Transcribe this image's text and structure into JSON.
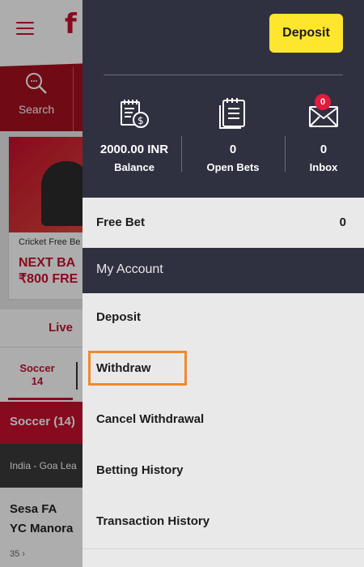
{
  "background": {
    "logo": "f",
    "search_label": "Search",
    "promo": {
      "caption": "Cricket Free Be",
      "title_line1": "NEXT BA",
      "title_line2": "₹800 FRE"
    },
    "live_label": "Live",
    "sport_tab": {
      "name": "Soccer",
      "count": "14"
    },
    "soccer_header": "Soccer  (14)",
    "league": "India - Goa Lea",
    "match": {
      "team1": "Sesa FA",
      "team2": "YC Manora",
      "count": "35 ›"
    }
  },
  "drawer": {
    "deposit_button": "Deposit",
    "stats": [
      {
        "value": "2000.00 INR",
        "label": "Balance",
        "icon": "balance-icon"
      },
      {
        "value": "0",
        "label": "Open Bets",
        "icon": "open-bets-icon"
      },
      {
        "value": "0",
        "label": "Inbox",
        "icon": "inbox-icon",
        "badge": "0"
      }
    ],
    "free_bet": {
      "label": "Free Bet",
      "value": "0"
    },
    "account_header": "My Account",
    "menu": [
      {
        "label": "Deposit"
      },
      {
        "label": "Withdraw"
      },
      {
        "label": "Cancel Withdrawal"
      },
      {
        "label": "Betting History"
      },
      {
        "label": "Transaction History"
      }
    ]
  },
  "colors": {
    "accent_red": "#c8102e",
    "drawer_dark": "#2f3140",
    "deposit_yellow": "#ffe62e",
    "highlight_orange": "#f08a2c"
  }
}
